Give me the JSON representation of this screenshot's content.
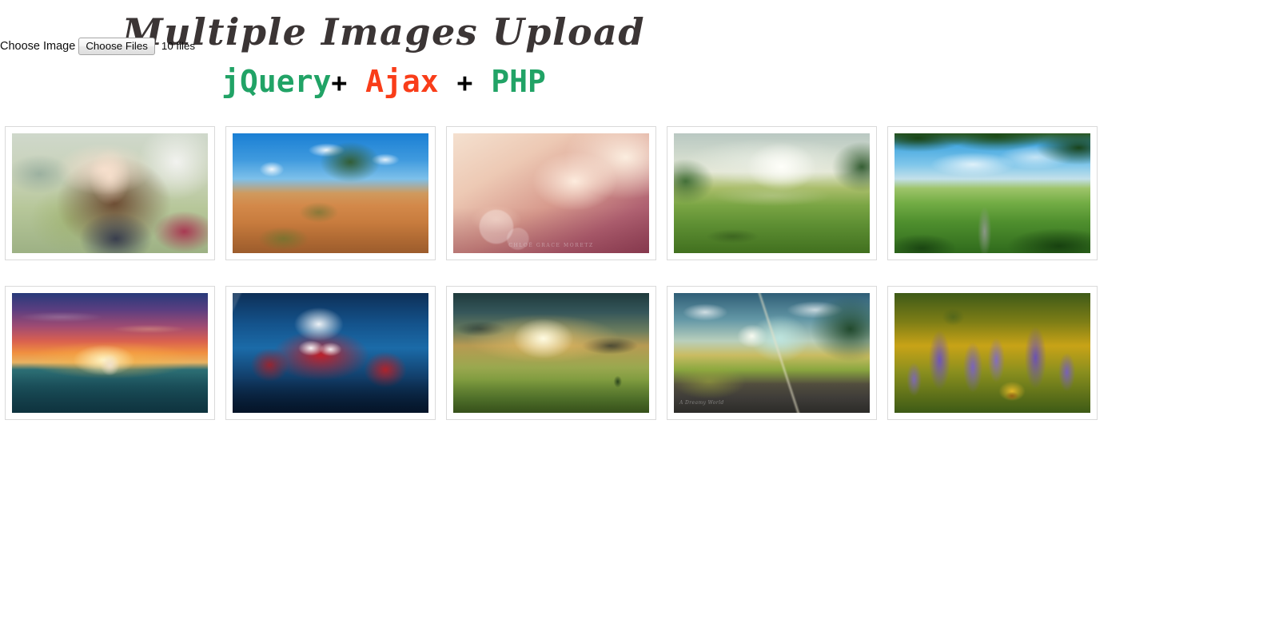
{
  "upload": {
    "field_label": "Choose Image",
    "button_label": "Choose Files",
    "status_text": "10 files"
  },
  "headings": {
    "title": "Multiple Images Upload",
    "subtitle": {
      "jquery": "jQuery",
      "plus_1": "+",
      "ajax": "Ajax",
      "plus_2": "+",
      "php": "PHP"
    }
  },
  "colors": {
    "green": "#21a366",
    "orange_red": "#f93d19",
    "title_gray": "#3b3535",
    "card_border": "#dadada",
    "page_background": "#ffffff"
  },
  "gallery": {
    "count": 10,
    "items": [
      {
        "index": 1,
        "name": "portrait-woman",
        "alt": "Young woman with long brown hair outdoors in a green field",
        "watermark": ""
      },
      {
        "index": 2,
        "name": "desert-rock",
        "alt": "Red sandstone desert rocks with lone tree under blue sky",
        "watermark": ""
      },
      {
        "index": 3,
        "name": "soft-pink-portrait",
        "alt": "Soft-focus warm portrait of a blonde young woman",
        "watermark": "CHLOË GRACE MORETZ"
      },
      {
        "index": 4,
        "name": "tea-hills",
        "alt": "Sunlit green tea plantation hills with sun rays",
        "watermark": ""
      },
      {
        "index": 5,
        "name": "green-valley",
        "alt": "Winding road through green rolling valley framed by leaves",
        "watermark": ""
      },
      {
        "index": 6,
        "name": "ship-sunset",
        "alt": "Sailing ship on the sea at a fiery sunset",
        "watermark": ""
      },
      {
        "index": 7,
        "name": "spiderman",
        "alt": "Spider-Man crawling on blue ice and glass",
        "watermark": ""
      },
      {
        "index": 8,
        "name": "sunburst-field",
        "alt": "Dramatic sunburst through clouds over a green field and path",
        "watermark": ""
      },
      {
        "index": 9,
        "name": "dreamy-road",
        "alt": "Dreamy country road with a giant planet on the horizon",
        "watermark": "A Dreamy World"
      },
      {
        "index": 10,
        "name": "lupine-flowers",
        "alt": "Purple lupine flowers with yellow blossoms behind",
        "watermark": ""
      }
    ]
  }
}
